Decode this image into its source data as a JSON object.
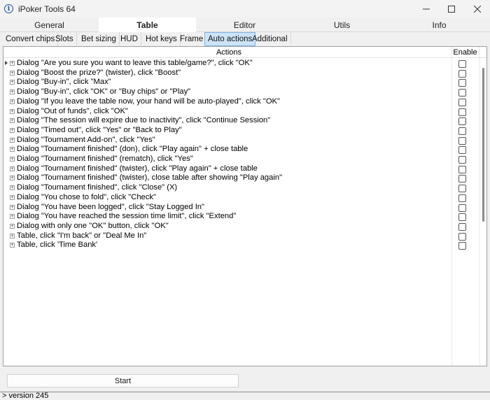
{
  "window": {
    "title": "iPoker Tools 64",
    "icon": "info-icon"
  },
  "main_tabs": [
    {
      "label": "General",
      "active": false
    },
    {
      "label": "Table",
      "active": true
    },
    {
      "label": "Editor",
      "active": false
    },
    {
      "label": "Utils",
      "active": false
    },
    {
      "label": "Info",
      "active": false
    }
  ],
  "sub_tabs": [
    {
      "label": "Convert chips",
      "active": false
    },
    {
      "label": "Slots",
      "active": false
    },
    {
      "label": "Bet sizing",
      "active": false
    },
    {
      "label": "HUD",
      "active": false
    },
    {
      "label": "Hot keys",
      "active": false
    },
    {
      "label": "Frame",
      "active": false
    },
    {
      "label": "Auto actions",
      "active": true
    },
    {
      "label": "Additional",
      "active": false
    }
  ],
  "table": {
    "columns": [
      "Actions",
      "Enable"
    ],
    "rows": [
      {
        "label": "Dialog \"Are you sure you want to leave this table/game?\", click \"OK\"",
        "enabled": false,
        "current": true
      },
      {
        "label": "Dialog \"Boost the prize?\" (twister), click \"Boost\"",
        "enabled": false
      },
      {
        "label": "Dialog \"Buy-in\", click \"Max\"",
        "enabled": false
      },
      {
        "label": "Dialog \"Buy-in\", click \"OK\" or \"Buy chips\" or \"Play\"",
        "enabled": false
      },
      {
        "label": "Dialog \"If you leave the table now, your hand will be auto-played\", click \"OK\"",
        "enabled": false
      },
      {
        "label": "Dialog \"Out of funds\", click \"OK\"",
        "enabled": false
      },
      {
        "label": "Dialog \"The session will expire due to inactivity\", click \"Continue Session\"",
        "enabled": false
      },
      {
        "label": "Dialog \"Timed out\", click \"Yes\" or \"Back to Play\"",
        "enabled": false
      },
      {
        "label": "Dialog \"Tournament Add-on\", click \"Yes\"",
        "enabled": false
      },
      {
        "label": "Dialog \"Tournament finished\" (don), click \"Play again\" + close table",
        "enabled": false
      },
      {
        "label": "Dialog \"Tournament finished\" (rematch), click \"Yes\"",
        "enabled": false
      },
      {
        "label": "Dialog \"Tournament finished\" (twister), click \"Play again\" + close table",
        "enabled": false
      },
      {
        "label": "Dialog \"Tournament finished\" (twister), close table after showing \"Play again\"",
        "enabled": false
      },
      {
        "label": "Dialog \"Tournament finished\", click \"Close\" (X)",
        "enabled": false
      },
      {
        "label": "Dialog \"You chose to fold\", click \"Check\"",
        "enabled": false
      },
      {
        "label": "Dialog \"You have been logged\", click \"Stay Logged In\"",
        "enabled": false
      },
      {
        "label": "Dialog \"You have reached the session time limit\", click \"Extend\"",
        "enabled": false
      },
      {
        "label": "Dialog with only one \"OK\" button, click \"OK\"",
        "enabled": false
      },
      {
        "label": "Table, click \"I'm back\" or \"Deal Me In\"",
        "enabled": false
      },
      {
        "label": "Table, click 'Time Bank'",
        "enabled": false
      }
    ]
  },
  "start_button": "Start",
  "status_text": "> version 245"
}
